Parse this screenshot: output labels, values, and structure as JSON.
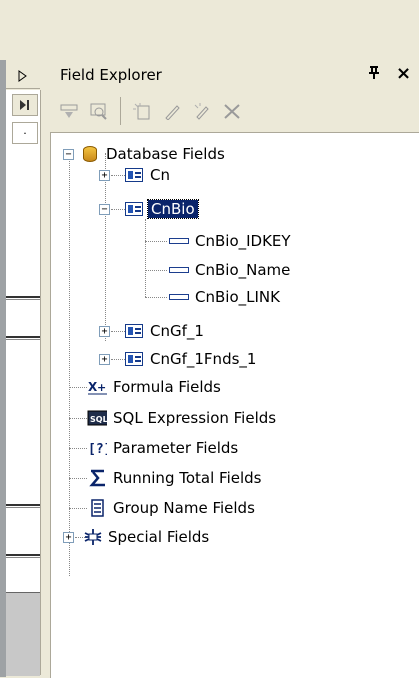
{
  "panel": {
    "title": "Field Explorer",
    "pin_glyph": "ᵽ",
    "close_glyph": "×"
  },
  "toolbar": {
    "buttons": [
      {
        "icon": "insert-field-icon"
      },
      {
        "icon": "browse-icon"
      },
      {
        "icon": "new-icon"
      },
      {
        "icon": "edit-icon"
      },
      {
        "icon": "rename-icon"
      },
      {
        "icon": "delete-icon"
      }
    ]
  },
  "tree": {
    "database_fields": "Database Fields",
    "tables": {
      "cn": "Cn",
      "cnbio": "CnBio",
      "cngf1": "CnGf_1",
      "cngf1fnds": "CnGf_1Fnds_1"
    },
    "cnbio_fields": [
      "CnBio_IDKEY",
      "CnBio_Name",
      "CnBio_LINK"
    ],
    "formula_fields": "Formula Fields",
    "sql_expression_fields": "SQL Expression Fields",
    "parameter_fields": "Parameter Fields",
    "running_total_fields": "Running Total Fields",
    "group_name_fields": "Group Name Fields",
    "special_fields": "Special Fields"
  },
  "colors": {
    "selection": "#0a246a",
    "panel_bg": "#ece9d8"
  }
}
